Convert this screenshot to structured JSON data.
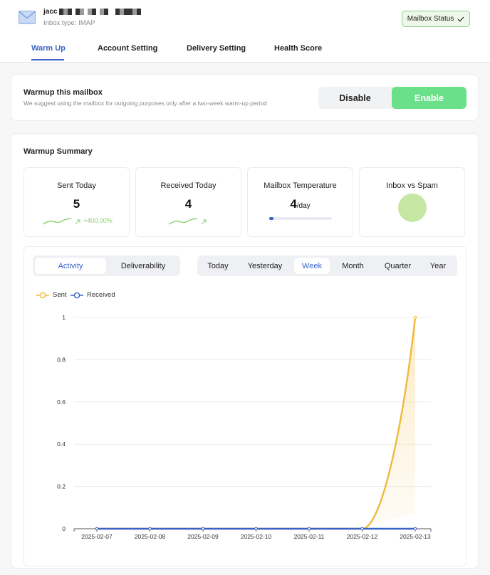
{
  "header": {
    "account_name": "jacc",
    "inbox_type": "Inbox type: IMAP",
    "status_button": "Mailbox Status",
    "status_icon": "check-icon"
  },
  "tabs": [
    {
      "label": "Warm Up",
      "active": true
    },
    {
      "label": "Account Setting",
      "active": false
    },
    {
      "label": "Delivery Setting",
      "active": false
    },
    {
      "label": "Health Score",
      "active": false
    }
  ],
  "warmup": {
    "title": "Warmup this mailbox",
    "description": "We suggest using the mailbox for outgoing purposes only after a two-week warm-up period",
    "disable_label": "Disable",
    "enable_label": "Enable",
    "selected": "Enable"
  },
  "summary": {
    "title": "Warmup Summary",
    "sent_today": {
      "label": "Sent Today",
      "value": "5",
      "trend": "+400.00%"
    },
    "received_today": {
      "label": "Received Today",
      "value": "4"
    },
    "temperature": {
      "label": "Mailbox Temperature",
      "value": "4",
      "unit": "/day",
      "fill_fraction": 0.07
    },
    "inbox_vs_spam": {
      "label": "Inbox vs Spam"
    }
  },
  "chart_controls": {
    "views": [
      {
        "label": "Activity",
        "active": true
      },
      {
        "label": "Deliverability",
        "active": false
      }
    ],
    "ranges": [
      {
        "label": "Today",
        "active": false
      },
      {
        "label": "Yesterday",
        "active": false
      },
      {
        "label": "Week",
        "active": true
      },
      {
        "label": "Month",
        "active": false
      },
      {
        "label": "Quarter",
        "active": false
      },
      {
        "label": "Year",
        "active": false
      }
    ]
  },
  "colors": {
    "accent": "#3a63c8",
    "enable_green": "#6be08a",
    "sent": "#f0b93a",
    "received": "#3a63c8"
  },
  "chart_data": {
    "type": "line",
    "categories": [
      "2025-02-07",
      "2025-02-08",
      "2025-02-09",
      "2025-02-10",
      "2025-02-11",
      "2025-02-12",
      "2025-02-13"
    ],
    "series": [
      {
        "name": "Sent",
        "values": [
          0,
          0,
          0,
          0,
          0,
          0,
          1
        ]
      },
      {
        "name": "Received",
        "values": [
          0,
          0,
          0,
          0,
          0,
          0,
          0
        ]
      }
    ],
    "yticks": [
      "0",
      "0.2",
      "0.4",
      "0.6",
      "0.8",
      "1"
    ],
    "ylim": [
      0,
      1
    ],
    "grid": true,
    "legend_position": "top-left"
  }
}
